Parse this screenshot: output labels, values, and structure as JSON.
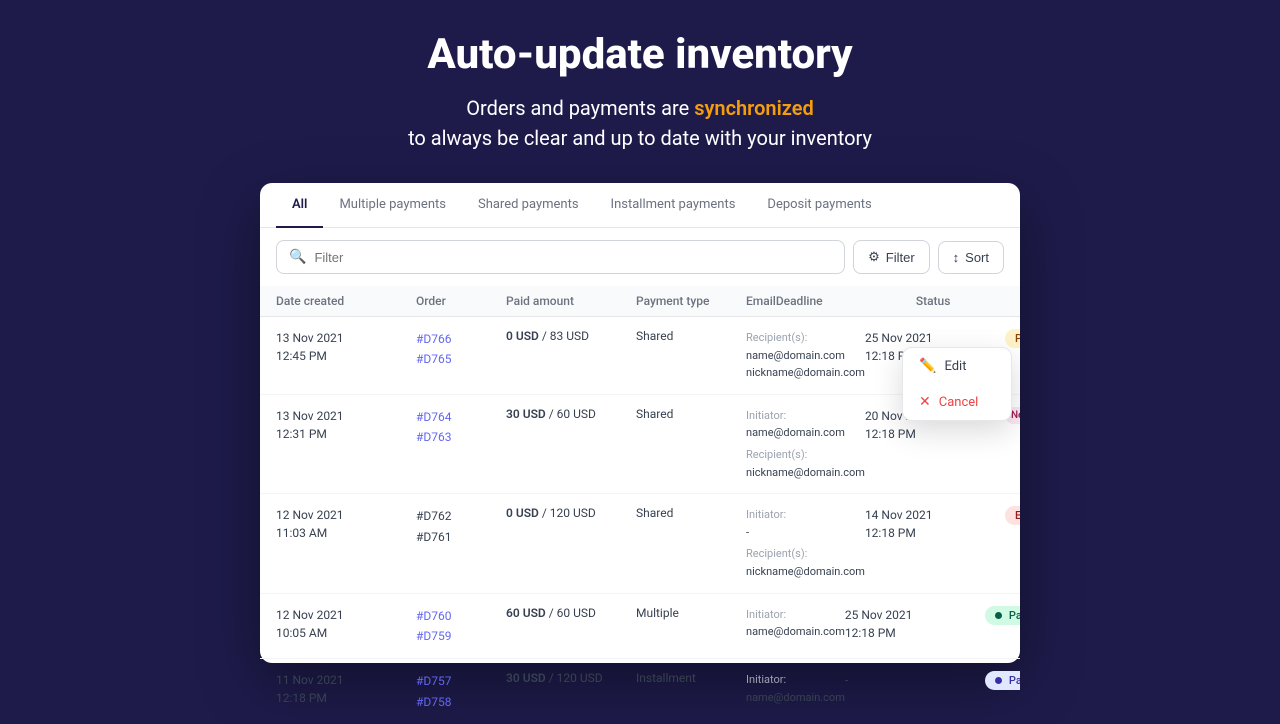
{
  "hero": {
    "title": "Auto-update inventory",
    "subtitle_plain": "Orders and payments are ",
    "subtitle_highlight": "synchronized",
    "subtitle_end": "\nto always be clear and up to date with your inventory"
  },
  "tabs": [
    {
      "label": "All",
      "active": true
    },
    {
      "label": "Multiple payments",
      "active": false
    },
    {
      "label": "Shared payments",
      "active": false
    },
    {
      "label": "Installment payments",
      "active": false
    },
    {
      "label": "Deposit payments",
      "active": false
    }
  ],
  "toolbar": {
    "search_placeholder": "Filter",
    "filter_label": "Filter",
    "sort_label": "Sort"
  },
  "table": {
    "headers": [
      "Date created",
      "Order",
      "Paid amount",
      "Payment type",
      "Email",
      "Deadline",
      "Status",
      ""
    ],
    "rows": [
      {
        "date": "13 Nov 2021\n12:45 PM",
        "orders": [
          "#D766",
          "#D765"
        ],
        "paid": "0 USD / 83 USD",
        "paid_bold": "0 USD",
        "type": "Shared",
        "email_initiator": "",
        "recipients_label": "Recipient(s):",
        "emails": [
          "name@domain.com",
          "nickname@domain.com"
        ],
        "deadline": "25 Nov 2021\n12:18 PM",
        "status": "Pending",
        "status_class": "badge-pending",
        "show_menu": true
      },
      {
        "date": "13 Nov 2021\n12:31 PM",
        "orders": [
          "#D764",
          "#D763"
        ],
        "paid": "30 USD / 60 USD",
        "paid_bold": "30 USD",
        "type": "Shared",
        "initiator_label": "Initiator:",
        "initiator_email": "name@domain.com",
        "recipients_label": "Recipient(s):",
        "emails": [
          "nickname@domain.com"
        ],
        "deadline": "20 Nov 2021\n12:18 PM",
        "status": "Need consideration",
        "status_class": "badge-need",
        "show_menu": false
      },
      {
        "date": "12 Nov 2021\n11:03 AM",
        "orders": [
          "#D762",
          "#D761"
        ],
        "paid": "0 USD / 120 USD",
        "paid_bold": "0 USD",
        "type": "Shared",
        "initiator_label": "Initiator:",
        "initiator_email": "-",
        "recipients_label": "Recipient(s):",
        "emails": [
          "nickname@domain.com"
        ],
        "deadline": "14 Nov 2021\n12:18 PM",
        "status": "Expired",
        "status_class": "badge-expired",
        "show_menu": false
      },
      {
        "date": "12 Nov 2021\n10:05 AM",
        "orders": [
          "#D760",
          "#D759"
        ],
        "paid": "60 USD / 60 USD",
        "paid_bold": "60 USD",
        "type": "Multiple",
        "initiator_label": "Initiator:",
        "initiator_email": "name@domain.com",
        "recipients_label": "",
        "emails": [],
        "deadline": "25 Nov 2021\n12:18 PM",
        "status": "Paid",
        "status_class": "badge-paid",
        "show_menu": false
      },
      {
        "date": "11 Nov 2021\n12:18 PM",
        "orders": [
          "#D757",
          "#D758"
        ],
        "paid": "30 USD / 120 USD",
        "paid_bold": "30 USD",
        "type": "Installment",
        "initiator_label": "Initiator:",
        "initiator_email": "name@domain.com",
        "recipients_label": "",
        "emails": [],
        "deadline": "-",
        "status": "Partially paid",
        "status_class": "badge-partial",
        "show_menu": false
      }
    ]
  },
  "context_menu": {
    "edit_label": "Edit",
    "cancel_label": "Cancel"
  },
  "colors": {
    "accent": "#f59e0b",
    "nav_active": "#1e1b4b",
    "link": "#6366f1"
  }
}
